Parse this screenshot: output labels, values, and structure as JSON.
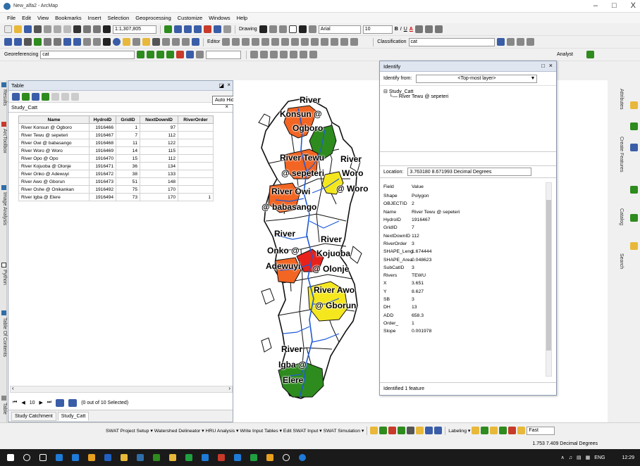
{
  "window": {
    "title": "New_alfa2 - ArcMap",
    "min": "–",
    "max": "□",
    "close": "X"
  },
  "menu": [
    "File",
    "Edit",
    "View",
    "Bookmarks",
    "Insert",
    "Selection",
    "Geoprocessing",
    "Customize",
    "Windows",
    "Help"
  ],
  "toolbar1": {
    "scale": "1:1,307,805",
    "drawing": "Drawing",
    "font": "Arial",
    "fontsize": "10",
    "bold": "B",
    "italic": "I",
    "underline": "U",
    "font_color": "A"
  },
  "toolbar2": {
    "editor": "Editor",
    "classification": "Classification",
    "classification_layer": "cat"
  },
  "toolbar3": {
    "georef": "Georeferencing",
    "georef_layer": "cat",
    "analyst": "Analyst"
  },
  "left_tabs": [
    "Results",
    "ArcToolbox",
    "Image Analysis",
    "Python",
    "Table Of Contents",
    "Table"
  ],
  "table_window": {
    "title": "Table",
    "layer": "Study_Catt",
    "tooltip": "Auto Hide",
    "columns": [
      "Name",
      "HydroID",
      "GridID",
      "NextDownID",
      "RiverOrder"
    ],
    "rows": [
      [
        "River Konsun @ Ogboro",
        "1916466",
        "1",
        "97",
        ""
      ],
      [
        "River Tewu @ sepeteri",
        "1916467",
        "7",
        "112",
        ""
      ],
      [
        "River Owi @ babasango",
        "1916468",
        "11",
        "122",
        ""
      ],
      [
        "River Woro @ Woro",
        "1916469",
        "14",
        "115",
        ""
      ],
      [
        "River Opo @ Opo",
        "1916470",
        "15",
        "112",
        ""
      ],
      [
        "River Kojuoba @ Olonje",
        "1916471",
        "36",
        "134",
        ""
      ],
      [
        "River Onko @ Adewuyi",
        "1916472",
        "38",
        "133",
        ""
      ],
      [
        "River Awo @ Gborun",
        "1916473",
        "51",
        "148",
        ""
      ],
      [
        "River Oshe @ Onikankan",
        "1916492",
        "75",
        "170",
        ""
      ],
      [
        "River Igba @ Elere",
        "1916494",
        "73",
        "170",
        "1"
      ]
    ],
    "nav_count": "10",
    "selection_text": "(0 out of 10 Selected)",
    "tabs": [
      "Study Catchment",
      "Study_Catt"
    ]
  },
  "map_labels": [
    {
      "text": "River",
      "cls": "l1"
    },
    {
      "text": "Konsun @",
      "cls": "l2"
    },
    {
      "text": "Ogboro",
      "cls": "l3"
    },
    {
      "text": "River Tewu",
      "cls": "l4"
    },
    {
      "text": "@ sepeteri",
      "cls": "l5"
    },
    {
      "text": "River",
      "cls": "l6"
    },
    {
      "text": "Woro",
      "cls": "l7"
    },
    {
      "text": "@ Woro",
      "cls": "l8"
    },
    {
      "text": "River Owi",
      "cls": "l9"
    },
    {
      "text": "@ babasango",
      "cls": "l10"
    },
    {
      "text": "River",
      "cls": "l11"
    },
    {
      "text": "River",
      "cls": "l12"
    },
    {
      "text": "Onko @",
      "cls": "l13"
    },
    {
      "text": "Kojuoba",
      "cls": "l14"
    },
    {
      "text": "Adewuyi",
      "cls": "l15"
    },
    {
      "text": "@ Olonje",
      "cls": "l16"
    },
    {
      "text": "River Awo",
      "cls": "l17"
    },
    {
      "text": "@ Gborun",
      "cls": "l18"
    },
    {
      "text": "River",
      "cls": "l19"
    },
    {
      "text": "Igba @",
      "cls": "l20"
    },
    {
      "text": "Elere",
      "cls": "l21"
    }
  ],
  "identify": {
    "title": "Identify",
    "from_label": "Identify from:",
    "from_value": "<Top-most layer>",
    "tree_root": "Study_Catt",
    "tree_child": "River Tewu @ sepeteri",
    "location_label": "Location:",
    "location_value": "3.763180  8.671993 Decimal Degrees",
    "field_header": "Field",
    "value_header": "Value",
    "fields": [
      [
        "Shape",
        "Polygon"
      ],
      [
        "OBJECTID",
        "2"
      ],
      [
        "Name",
        "River Tewu @ sepeteri"
      ],
      [
        "HydroID",
        "1916467"
      ],
      [
        "GridID",
        "7"
      ],
      [
        "NextDownID",
        "112"
      ],
      [
        "RiverOrder",
        "3"
      ],
      [
        "SHAPE_Leng",
        "1.674444"
      ],
      [
        "SHAPE_Area",
        "0.048623"
      ],
      [
        "SubCatID",
        "3"
      ],
      [
        "Rivers",
        "TEWU"
      ],
      [
        "X",
        "3.651"
      ],
      [
        "Y",
        "8.627"
      ],
      [
        "SB",
        "3"
      ],
      [
        "DH",
        "13"
      ],
      [
        "ADD",
        "658.3"
      ],
      [
        "Order_",
        "1"
      ],
      [
        "Slope",
        "0.001978"
      ]
    ],
    "status": "Identified 1 feature"
  },
  "right_tabs": [
    "Attributes",
    "Create Features",
    "Catalog",
    "Search"
  ],
  "swat": [
    "SWAT Project Setup",
    "Watershed Delineator",
    "HRU Analysis",
    "Write Input Tables",
    "Edit SWAT Input",
    "SWAT Simulation"
  ],
  "swat_labeling": "Labeling",
  "swat_fast": "Fast",
  "statusbar": "1.753  7.409 Decimal Degrees",
  "taskbar": {
    "lang": "ENG",
    "time": "12:29"
  },
  "colors": {
    "orange": "#f26522",
    "green": "#2e8b1e",
    "yellow": "#f5e71e",
    "red": "#e8221a",
    "river": "#1e5bd8"
  }
}
